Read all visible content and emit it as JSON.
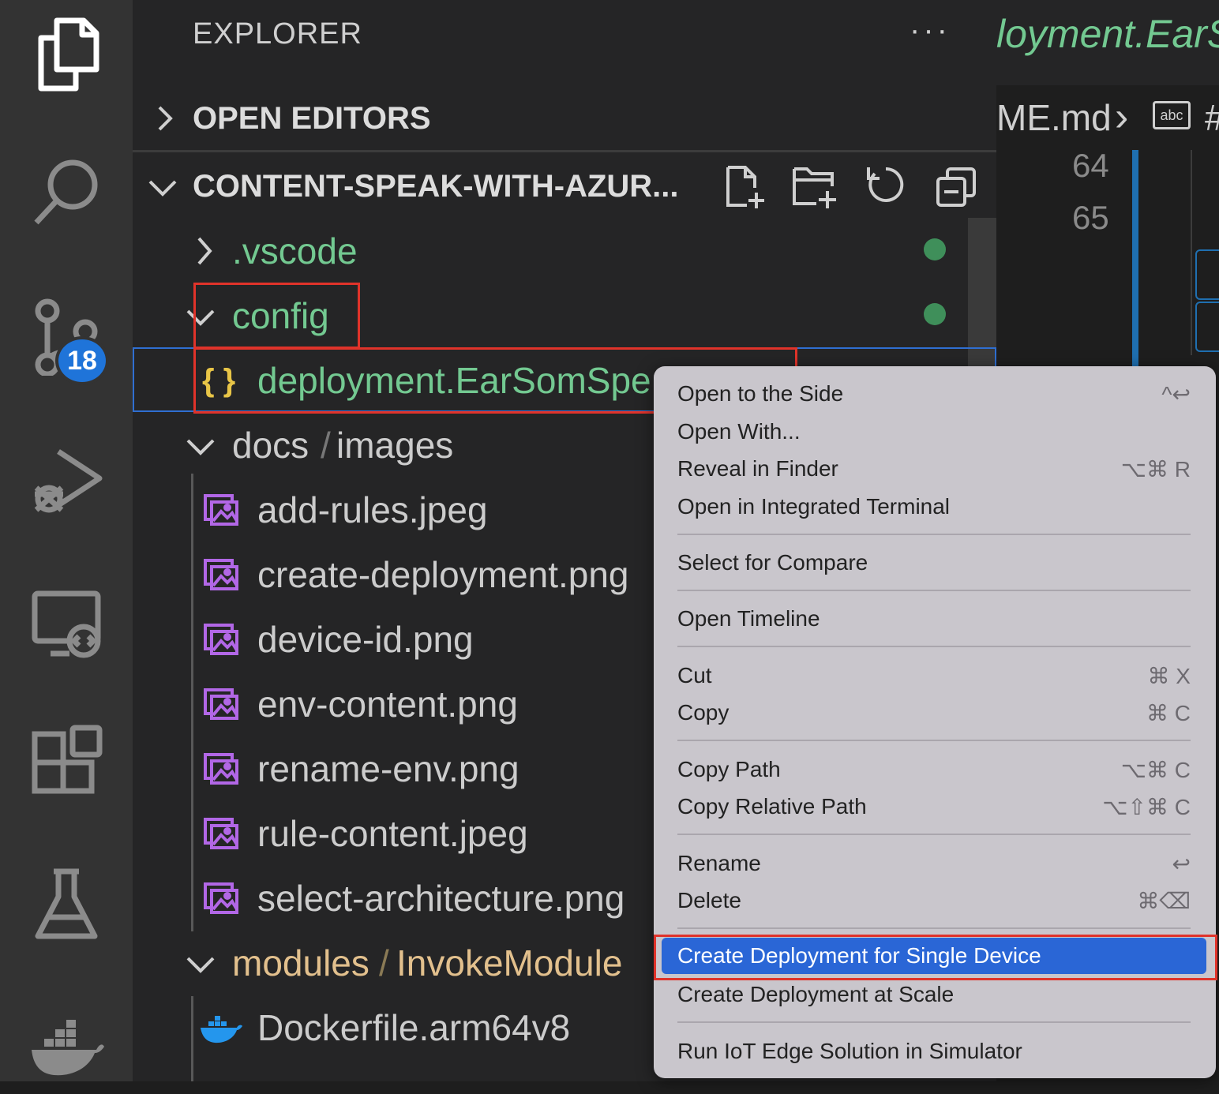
{
  "activity_bar": {
    "source_control_badge": "18"
  },
  "explorer": {
    "title": "EXPLORER",
    "more_actions": "···",
    "open_editors_label": "OPEN EDITORS",
    "workspace_label": "CONTENT-SPEAK-WITH-AZUR...",
    "tree": {
      "vscode": ".vscode",
      "config": "config",
      "deployment_file": "deployment.EarSomSpe",
      "json_icon": "{ }",
      "docs": "docs",
      "images": "images",
      "path_sep": "/",
      "images_files": [
        "add-rules.jpeg",
        "create-deployment.png",
        "device-id.png",
        "env-content.png",
        "rename-env.png",
        "rule-content.jpeg",
        "select-architecture.png"
      ],
      "modules": "modules",
      "invoke_module": "InvokeModule",
      "dockerfile": "Dockerfile.arm64v8"
    }
  },
  "editor": {
    "tab_title": "loyment.EarS",
    "breadcrumb_file": "ME.md",
    "breadcrumb_chevron": "›",
    "breadcrumb_hash": "#",
    "line_numbers": [
      "64",
      "65"
    ]
  },
  "context_menu": {
    "items": [
      {
        "label": "Open to the Side",
        "shortcut": "^↩"
      },
      {
        "label": "Open With...",
        "shortcut": ""
      },
      {
        "label": "Reveal in Finder",
        "shortcut": "⌥⌘ R"
      },
      {
        "label": "Open in Integrated Terminal",
        "shortcut": ""
      },
      {
        "label": "Select for Compare",
        "shortcut": ""
      },
      {
        "label": "Open Timeline",
        "shortcut": ""
      },
      {
        "label": "Cut",
        "shortcut": "⌘ X"
      },
      {
        "label": "Copy",
        "shortcut": "⌘ C"
      },
      {
        "label": "Copy Path",
        "shortcut": "⌥⌘ C"
      },
      {
        "label": "Copy Relative Path",
        "shortcut": "⌥⇧⌘ C"
      },
      {
        "label": "Rename",
        "shortcut": "↩"
      },
      {
        "label": "Delete",
        "shortcut": "⌘⌫"
      },
      {
        "label": "Create Deployment for Single Device",
        "shortcut": ""
      },
      {
        "label": "Create Deployment at Scale",
        "shortcut": ""
      },
      {
        "label": "Run IoT Edge Solution in Simulator",
        "shortcut": ""
      }
    ]
  },
  "colors": {
    "accent_blue": "#2a66d6",
    "annotation_red": "#e0332a",
    "git_green": "#73c991",
    "folder_yellow": "#e2c08d"
  }
}
